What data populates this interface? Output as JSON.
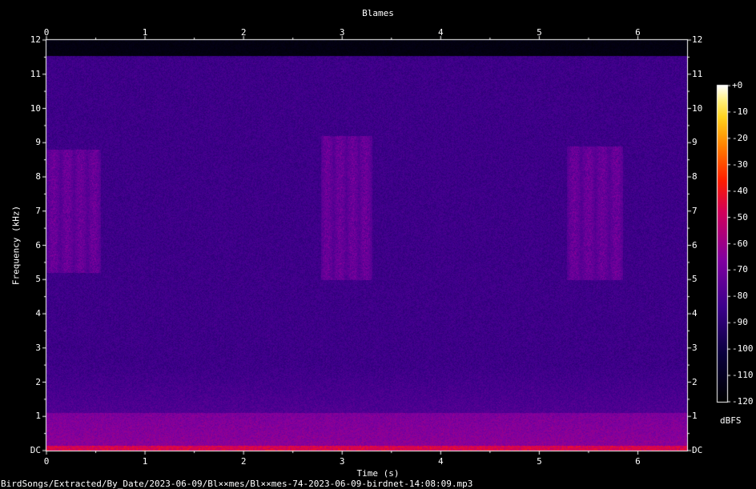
{
  "chart_data": {
    "type": "heatmap",
    "title": "Blames",
    "xlabel": "Time (s)",
    "ylabel": "Frequency (kHz)",
    "xlim": [
      0,
      6.5
    ],
    "ylim": [
      0,
      12
    ],
    "x_ticks": [
      "0",
      "1",
      "2",
      "3",
      "4",
      "5",
      "6"
    ],
    "y_ticks": [
      "DC",
      "1",
      "2",
      "3",
      "4",
      "5",
      "6",
      "7",
      "8",
      "9",
      "10",
      "11",
      "12"
    ],
    "colorbar": {
      "unit": "dBFS",
      "ticks": [
        "+0",
        "-10",
        "-20",
        "-30",
        "-40",
        "-50",
        "-60",
        "-70",
        "-80",
        "-90",
        "-100",
        "-110",
        "-120"
      ],
      "range": [
        -120,
        0
      ]
    },
    "energy_bands": [
      {
        "label": "low-frequency noise",
        "freq_khz": [
          0,
          1.1
        ],
        "time_s": [
          0,
          6.5
        ]
      },
      {
        "label": "call 1",
        "time_s": [
          0.0,
          0.55
        ],
        "freq_khz": [
          5.2,
          8.8
        ]
      },
      {
        "label": "call 2",
        "time_s": [
          2.78,
          3.3
        ],
        "freq_khz": [
          5.0,
          9.2
        ]
      },
      {
        "label": "call 3",
        "time_s": [
          5.28,
          5.85
        ],
        "freq_khz": [
          5.0,
          8.9
        ]
      }
    ]
  },
  "footer": {
    "path": "BirdSongs/Extracted/By_Date/2023-06-09/Bl××mes/Bl××mes-74-2023-06-09-birdnet-14:08:09.mp3"
  }
}
